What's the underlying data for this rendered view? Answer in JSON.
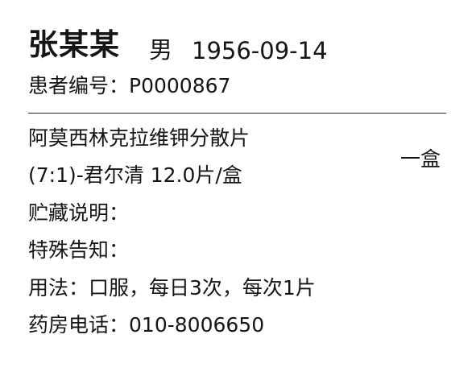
{
  "patient": {
    "name": "张某某",
    "gender": "男",
    "birth_date": "1956-09-14",
    "id_label": "患者编号：",
    "id_value": "P0000867"
  },
  "drug": {
    "name_line1": "阿莫西林克拉维钾分散片",
    "name_line2": "(7:1)-君尔清 12.0片/盒",
    "quantity": "一盒",
    "storage_label": "贮藏说明：",
    "storage_value": "",
    "notice_label": "特殊告知：",
    "notice_value": "",
    "usage_label": "用法：",
    "usage_value": "口服，每日3次，每次1片",
    "pharmacy_phone_label": "药房电话：",
    "pharmacy_phone_value": "010-8006650"
  }
}
